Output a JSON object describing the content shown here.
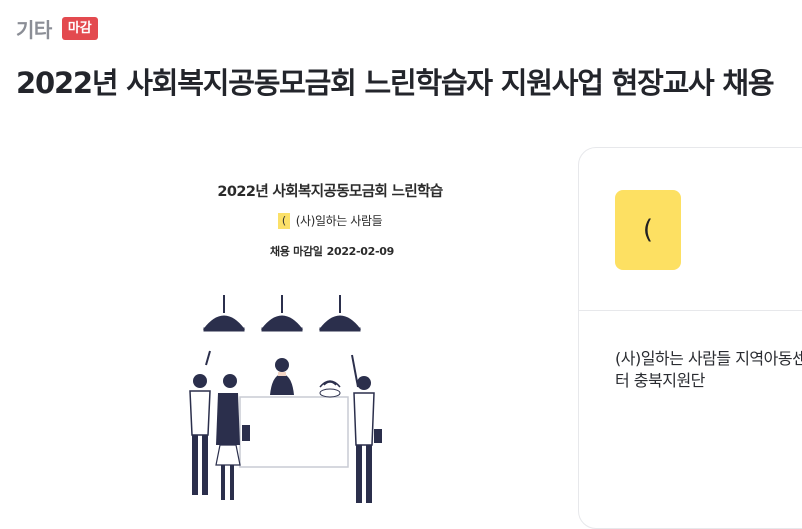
{
  "header": {
    "category": "기타",
    "status_badge": "마감",
    "title": "2022년 사회복지공동모금회 느린학습자 지원사업 현장교사 채용"
  },
  "poster": {
    "title": "2022년 사회복지공동모금회 느린학습",
    "logo_glyph": "(",
    "org": "(사)일하는 사람들",
    "deadline_label": "채용 마감일",
    "deadline_date": "2022-02-09"
  },
  "org_card": {
    "logo_glyph": "(",
    "name": "(사)일하는 사람들 지역아동센터 충북지원단"
  },
  "colors": {
    "badge": "#e34a4f",
    "logo_yellow": "#fde062",
    "lamp_navy": "#2b2f4c"
  }
}
